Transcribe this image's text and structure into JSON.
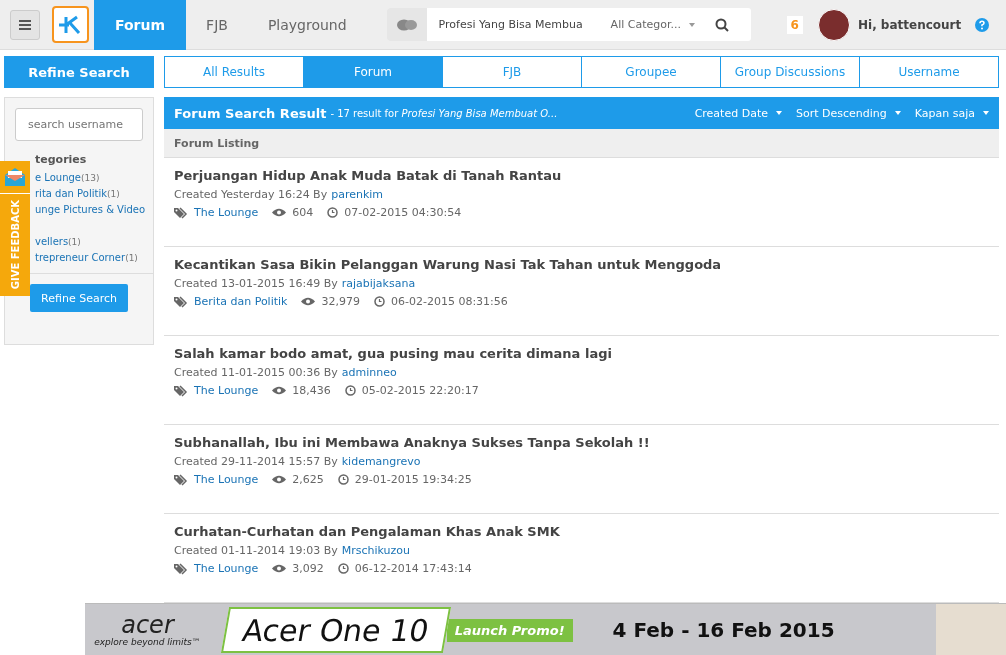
{
  "topbar": {
    "nav": [
      {
        "label": "Forum",
        "selected": true
      },
      {
        "label": "FJB",
        "selected": false
      },
      {
        "label": "Playground",
        "selected": false
      }
    ],
    "search": {
      "value": "Profesi Yang Bisa Membua",
      "category": "All Categor..."
    },
    "notifications": "6",
    "greeting": "Hi, battencourt"
  },
  "sidebar": {
    "title": "Refine Search",
    "username_placeholder": "search username",
    "categories_heading": "tegories",
    "categories": [
      {
        "name": "e Lounge",
        "count": "(13)"
      },
      {
        "name": "rita dan Politik",
        "count": "(1)"
      },
      {
        "name": "unge Pictures & Video"
      },
      {
        "name": "vellers",
        "count": "(1)"
      },
      {
        "name": "trepreneur Corner",
        "count": "(1)"
      }
    ],
    "button": "Refine Search"
  },
  "feedback_tab": "GIVE FEEDBACK",
  "tabs": [
    {
      "label": "All Results",
      "selected": false
    },
    {
      "label": "Forum",
      "selected": true
    },
    {
      "label": "FJB",
      "selected": false
    },
    {
      "label": "Groupee",
      "selected": false
    },
    {
      "label": "Group Discussions",
      "selected": false
    },
    {
      "label": "Username",
      "selected": false
    }
  ],
  "results_header": {
    "title": "Forum Search Result",
    "summary": "- 17 result for *Profesi Yang Bisa Membuat O...*",
    "filters": [
      "Created Date",
      "Sort Descending",
      "Kapan saja"
    ]
  },
  "listing_heading": "Forum Listing",
  "threads": [
    {
      "title": "Perjuangan Hidup Anak Muda Batak di Tanah Rantau",
      "created": "Created Yesterday 16:24 By",
      "author": "parenkim",
      "category": "The Lounge",
      "views": "604",
      "last_post": "07-02-2015 04:30:54"
    },
    {
      "title": "Kecantikan Sasa Bikin Pelanggan Warung Nasi Tak Tahan untuk Menggoda",
      "created": "Created 13-01-2015 16:49 By",
      "author": "rajabijaksana",
      "category": "Berita dan Politik",
      "views": "32,979",
      "last_post": "06-02-2015 08:31:56"
    },
    {
      "title": "Salah kamar bodo amat, gua pusing mau cerita dimana lagi",
      "created": "Created 11-01-2015 00:36 By",
      "author": "adminneo",
      "category": "The Lounge",
      "views": "18,436",
      "last_post": "05-02-2015 22:20:17"
    },
    {
      "title": "Subhanallah, Ibu ini Membawa Anaknya Sukses Tanpa Sekolah !!",
      "created": "Created 29-11-2014 15:57 By",
      "author": "kidemangrevo",
      "category": "The Lounge",
      "views": "2,625",
      "last_post": "29-01-2015 19:34:25"
    },
    {
      "title": "Curhatan-Curhatan dan Pengalaman Khas Anak SMK",
      "created": "Created 01-11-2014 19:03 By",
      "author": "Mrschikuzou",
      "category": "The Lounge",
      "views": "3,092",
      "last_post": "06-12-2014 17:43:14"
    }
  ],
  "ad_banner": {
    "brand": "acer",
    "tagline": "explore beyond limits™",
    "product": "Acer One 10",
    "promo": "Launch Promo!",
    "dates": "4 Feb - 16 Feb 2015"
  }
}
